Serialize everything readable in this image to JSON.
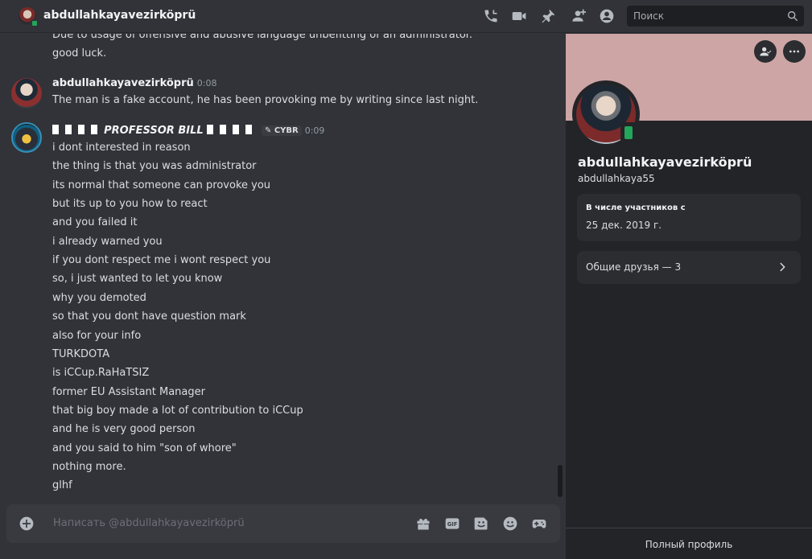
{
  "header": {
    "title": "abdullahkayavezirköprü",
    "search_placeholder": "Поиск",
    "icons": [
      "phone-call-icon",
      "video-icon",
      "pin-icon",
      "add-member-icon",
      "user-profile-icon",
      "search-icon"
    ]
  },
  "messages_top": [
    "Due to usage of offensive and abusive language unbefitting of an administrator.",
    "good luck."
  ],
  "msg1": {
    "author": "abdullahkayavezirköprü",
    "time": "0:08",
    "text": "The man is a fake account, he has been provoking me by writing since last night."
  },
  "msg2": {
    "author": "PROFESSOR BILL",
    "tag": "CYBR",
    "time": "0:09",
    "lines": [
      "i dont interested in reason",
      "the thing is that you was administrator",
      "its normal that someone can provoke you",
      "but its up to you how to react",
      "and you failed it",
      "i already warned you",
      "if you dont respect me i wont respect you",
      "so, i just wanted to let you  know",
      "why you demoted",
      "so that you dont have question mark",
      "also for your info",
      "TURKDOTA",
      "is iCCup.RaHaTSIZ",
      "former EU Assistant Manager",
      "that big boy made a lot of contribution to iCCup",
      "and he is very good person",
      "and you said to him \"son of whore\"",
      "nothing more.",
      "glhf"
    ]
  },
  "composer": {
    "placeholder": "Написать @abdullahkayavezirköprü",
    "icons": [
      "gift-icon",
      "gif-icon",
      "sticker-icon",
      "emoji-icon",
      "activity-icon"
    ]
  },
  "profile": {
    "display_name": "abdullahkayavezirköprü",
    "username": "abdullahkaya55",
    "member_since_label": "В числе участников с",
    "member_since_value": "25 дек. 2019 г.",
    "mutual_friends": "Общие друзья — 3",
    "full_profile": "Полный профиль",
    "banner_color": "#cda5a5",
    "status_color": "#23a55a"
  }
}
